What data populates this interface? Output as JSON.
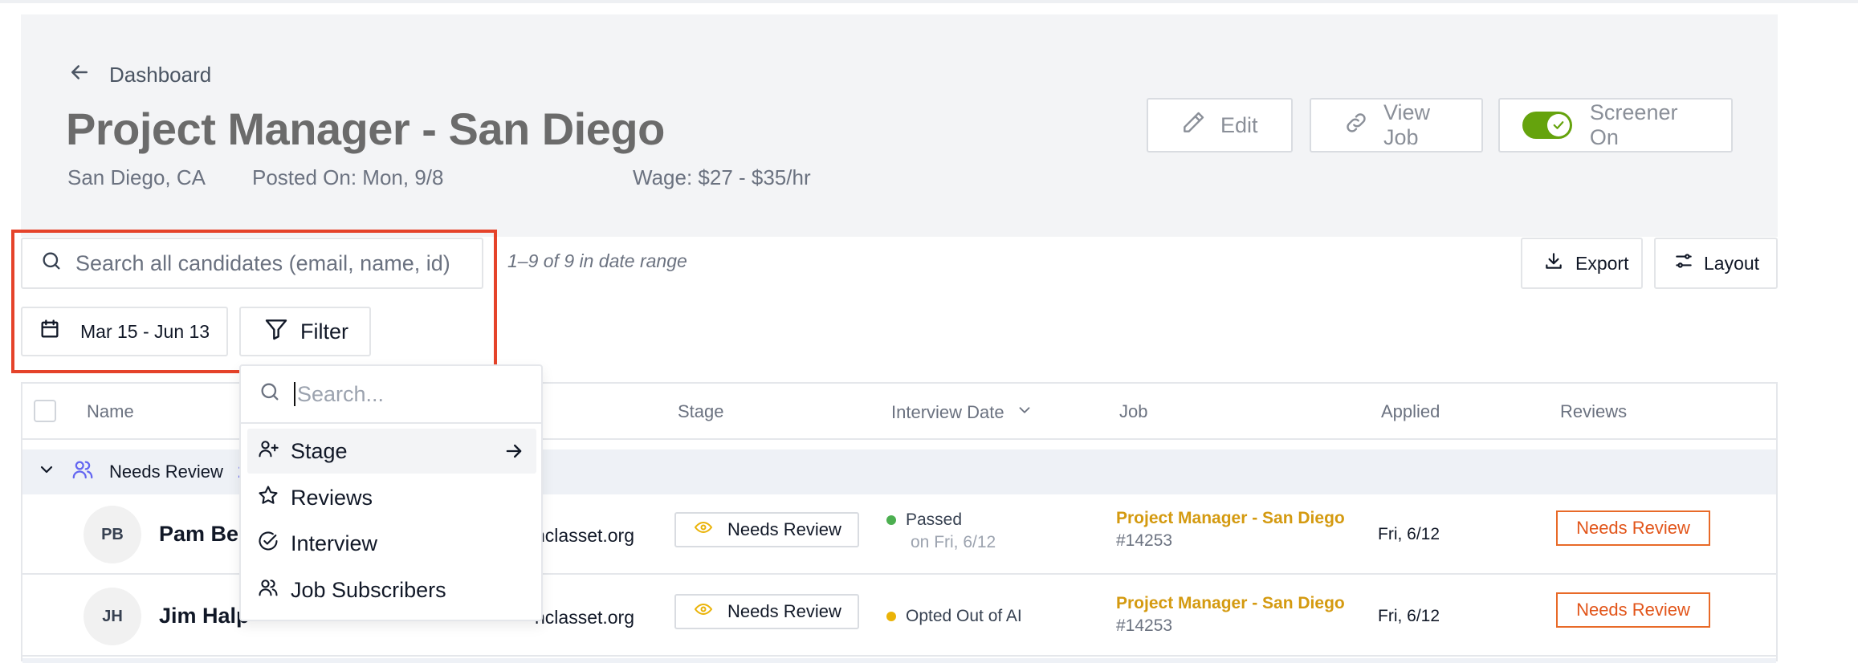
{
  "header": {
    "back_label": "Dashboard",
    "title": "Project Manager - San Diego",
    "location": "San Diego, CA",
    "posted": "Posted On: Mon, 9/8",
    "wage": "Wage: $27 - $35/hr",
    "edit_label": "Edit",
    "view_job_label": "View Job",
    "screener_label": "Screener On",
    "screener_on": true
  },
  "toolbar": {
    "search_placeholder": "Search all candidates (email, name, id)",
    "count_text": "1–9 of 9 in date range",
    "export_label": "Export",
    "layout_label": "Layout",
    "date_range": "Mar 15 - Jun 13",
    "filter_label": "Filter"
  },
  "table": {
    "columns": {
      "name": "Name",
      "stage": "Stage",
      "interview_date": "Interview Date",
      "job": "Job",
      "applied": "Applied",
      "reviews": "Reviews"
    },
    "group": {
      "label": "Needs Review",
      "count": "2"
    },
    "rows": [
      {
        "initials": "PB",
        "name": "Pam Bee",
        "email": "nclasset.org",
        "stage": "Needs Review",
        "interview_status": "Passed",
        "interview_detail": "on Fri, 6/12",
        "interview_color": "#4caf50",
        "job_title": "Project Manager - San Diego",
        "job_id": "#14253",
        "applied": "Fri, 6/12",
        "review": "Needs Review"
      },
      {
        "initials": "JH",
        "name": "Jim Halp",
        "email": "nclasset.org",
        "stage": "Needs Review",
        "interview_status": "Opted Out of AI",
        "interview_detail": "",
        "interview_color": "#eab308",
        "job_title": "Project Manager - San Diego",
        "job_id": "#14253",
        "applied": "Fri, 6/12",
        "review": "Needs Review"
      }
    ]
  },
  "filter_menu": {
    "search_placeholder": "Search...",
    "items": [
      {
        "label": "Stage",
        "icon": "user-plus-icon"
      },
      {
        "label": "Reviews",
        "icon": "star-icon"
      },
      {
        "label": "Interview",
        "icon": "check-circle-icon"
      },
      {
        "label": "Job Subscribers",
        "icon": "users-icon"
      }
    ]
  },
  "colors": {
    "accent_orange": "#e2551a",
    "job_link": "#d49a10",
    "toggle_green": "#65a30d",
    "highlight_red": "#e5432a"
  }
}
